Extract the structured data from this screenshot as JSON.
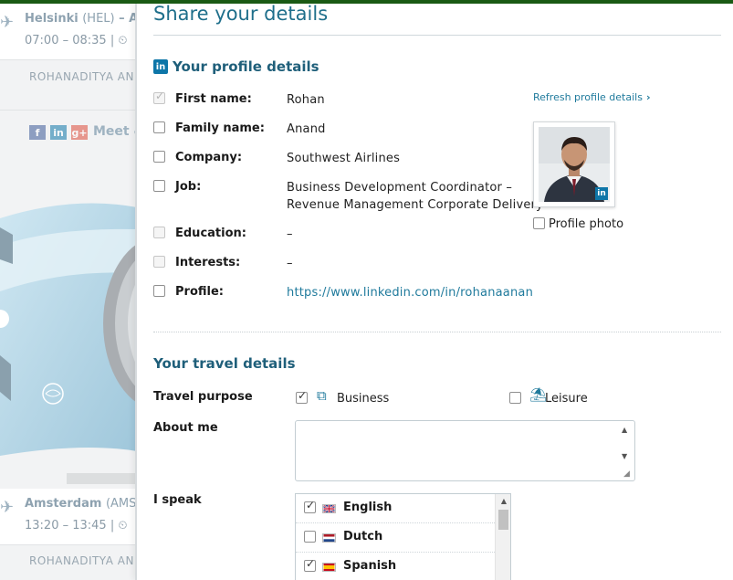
{
  "background": {
    "flights": [
      {
        "city": "Helsinki",
        "code": "(HEL)",
        "suffix": " – Am",
        "time": "07:00 – 08:35 | ⏲"
      },
      {
        "city": "Amsterdam",
        "code": "(AMS)",
        "suffix": " – ",
        "time": "13:20 – 13:45 | ⏲"
      }
    ],
    "passenger_name": "ROHANADITYA AN",
    "passenger_name_2": "ROHANADITYA AN",
    "meet_text": "Meet &",
    "social": {
      "facebook": "f",
      "linkedin": "in",
      "google_plus": "g+"
    }
  },
  "modal": {
    "title": "Share your details",
    "profile_section": {
      "title": "Your profile details",
      "badge": "in",
      "refresh_label": "Refresh profile details",
      "photo_label": "Profile photo",
      "fields": [
        {
          "label": "First name:",
          "value": "Rohan",
          "checked": true,
          "disabled": true
        },
        {
          "label": "Family name:",
          "value": "Anand",
          "checked": false,
          "disabled": false
        },
        {
          "label": "Company:",
          "value": "Southwest Airlines",
          "checked": false,
          "disabled": false
        },
        {
          "label": "Job:",
          "value": "Business Development Coordinator –",
          "value2": "Revenue Management Corporate Delivery",
          "checked": false,
          "disabled": false
        },
        {
          "label": "Education:",
          "value": "–",
          "checked": false,
          "disabled": true
        },
        {
          "label": "Interests:",
          "value": "–",
          "checked": false,
          "disabled": true
        },
        {
          "label": "Profile:",
          "value": "https://www.linkedin.com/in/rohanaanand",
          "checked": false,
          "disabled": false
        }
      ]
    },
    "travel_section": {
      "title": "Your travel details",
      "purpose_label": "Travel purpose",
      "business_label": "Business",
      "business_checked": true,
      "leisure_label": "Leisure",
      "leisure_checked": false,
      "about_label": "About me",
      "about_value": "",
      "speak_label": "I speak",
      "languages": [
        {
          "name": "English",
          "checked": true
        },
        {
          "name": "Dutch",
          "checked": false
        },
        {
          "name": "Spanish",
          "checked": true
        }
      ]
    }
  },
  "colors": {
    "accent": "#1f6f8b",
    "linkedin": "#0e76a8",
    "topbar": "#1a5a14"
  }
}
